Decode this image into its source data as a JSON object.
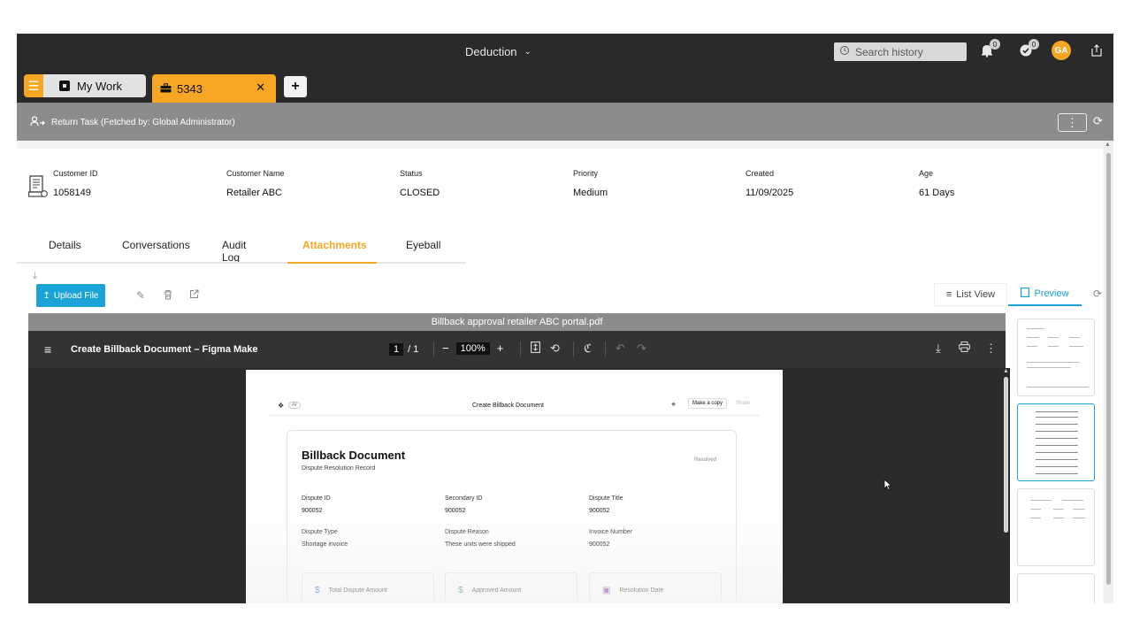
{
  "header": {
    "title": "Deduction",
    "search_placeholder": "Search history",
    "notifications_count": "0",
    "tasks_count": "0",
    "avatar_initials": "GA"
  },
  "tabs": {
    "mywork_label": "My Work",
    "active_label": "5343"
  },
  "task": {
    "label": "Return Task (Fetched by: Global Administrator)"
  },
  "info": {
    "fields": [
      {
        "label": "Customer ID",
        "value": "1058149"
      },
      {
        "label": "Customer Name",
        "value": "Retailer ABC"
      },
      {
        "label": "Status",
        "value": "CLOSED"
      },
      {
        "label": "Priority",
        "value": "Medium"
      },
      {
        "label": "Created",
        "value": "11/09/2025"
      },
      {
        "label": "Age",
        "value": "61 Days"
      }
    ]
  },
  "subtabs": [
    "Details",
    "Conversations",
    "Audit Log",
    "Attachments",
    "Eyeball"
  ],
  "attachments": {
    "upload_label": "Upload File",
    "list_view_label": "List View",
    "preview_label": "Preview",
    "file_name": "Billback approval retailer ABC portal.pdf"
  },
  "viewer": {
    "doc_title": "Create Billback Document – Figma Make",
    "page_current": "1",
    "page_total": "/ 1",
    "zoom": "100%"
  },
  "pdf": {
    "logo_badge": "AI",
    "head_title": "Create Billback Document",
    "make_copy": "Make a copy",
    "share": "Share",
    "card_title": "Billback Document",
    "card_subtitle": "Dispute Resolution Record",
    "status": "Resolved",
    "fields": [
      {
        "label": "Dispute ID",
        "value": "900052"
      },
      {
        "label": "Secondary ID",
        "value": "900052"
      },
      {
        "label": "Dispute Title",
        "value": "900052"
      },
      {
        "label": "Dispute Type",
        "value": "Shortage invoice"
      },
      {
        "label": "Dispute Reason",
        "value": "These units were shipped"
      },
      {
        "label": "Invoice Number",
        "value": "900052"
      }
    ],
    "summary": [
      {
        "icon": "$",
        "label": "Total Dispute Amount",
        "color": "#2a6fdb"
      },
      {
        "icon": "$",
        "label": "Approved Amount",
        "color": "#2e9a4c"
      },
      {
        "icon": "▣",
        "label": "Resolution Date",
        "color": "#8e44ad"
      }
    ]
  },
  "colors": {
    "accent": "#f5a623",
    "primary": "#1ba2d6",
    "topbar": "#2a2a2a"
  }
}
